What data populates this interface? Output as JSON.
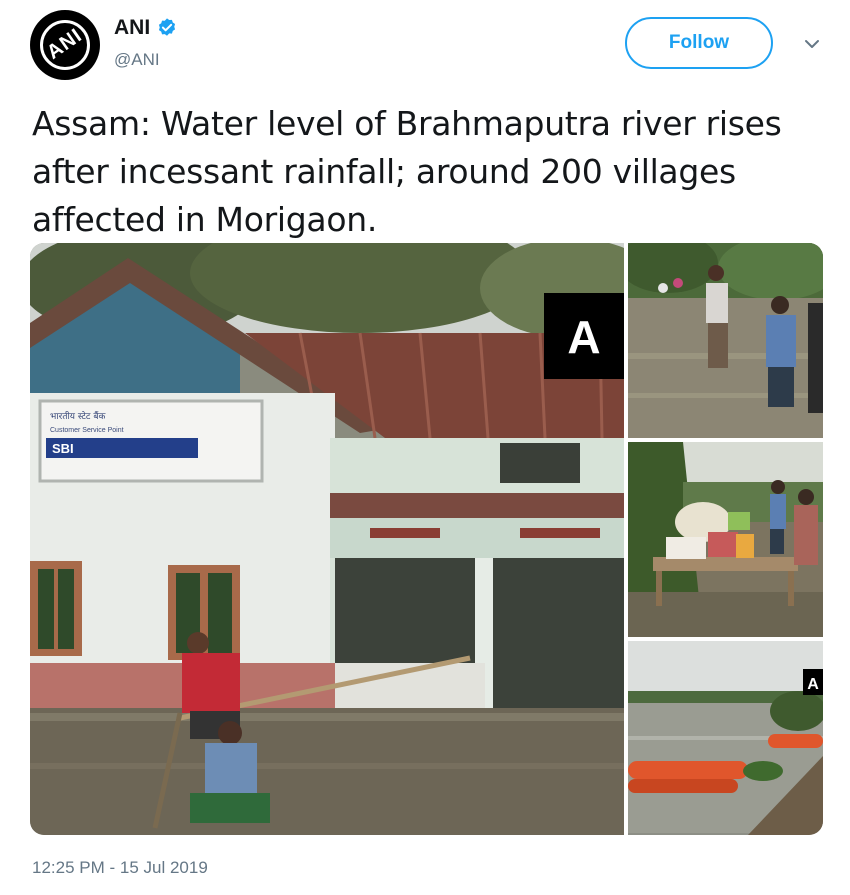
{
  "header": {
    "avatar_text": "ANI",
    "display_name": "ANI",
    "handle": "@ANI",
    "follow_label": "Follow",
    "verified_icon": "verified-badge-icon",
    "more_icon": "chevron-down-icon"
  },
  "tweet": {
    "text": "Assam: Water level of Brahmaputra river rises after incessant rainfall; around 200 villages affected in Morigaon.",
    "timestamp": "12:25 PM - 15 Jul 2019"
  },
  "media": {
    "watermark_main": "A",
    "watermark_small": "A",
    "sign_brand": "SBI",
    "sign_line1": "भारतीय स्टेट बैंक",
    "sign_line2": "Customer Service Point"
  },
  "colors": {
    "accent": "#1da1f2",
    "text_primary": "#14171a",
    "text_secondary": "#657786"
  }
}
